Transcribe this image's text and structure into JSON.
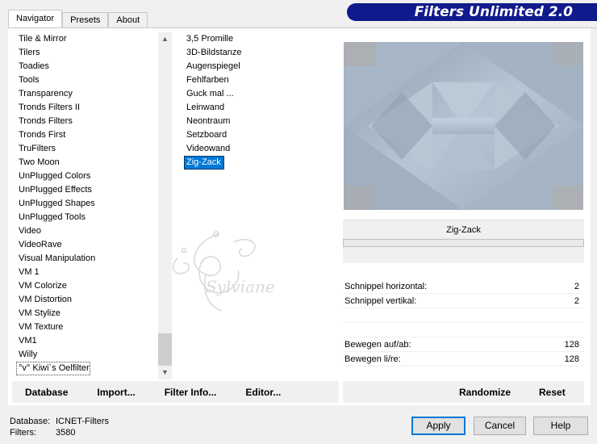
{
  "tabs": [
    {
      "label": "Navigator",
      "active": true
    },
    {
      "label": "Presets",
      "active": false
    },
    {
      "label": "About",
      "active": false
    }
  ],
  "banner": {
    "title": "Filters Unlimited 2.0",
    "color": "#111a8c"
  },
  "categories": [
    "Tile & Mirror",
    "Tilers",
    "Toadies",
    "Tools",
    "Transparency",
    "Tronds Filters II",
    "Tronds Filters",
    "Tronds First",
    "TruFilters",
    "Two Moon",
    "UnPlugged Colors",
    "UnPlugged Effects",
    "UnPlugged Shapes",
    "UnPlugged Tools",
    "Video",
    "VideoRave",
    "Visual Manipulation",
    "VM 1",
    "VM Colorize",
    "VM Distortion",
    "VM Stylize",
    "VM Texture",
    "VM1",
    "Willy",
    "°v° Kiwi`s Oelfilter"
  ],
  "selected_category": "°v° Kiwi`s Oelfilter",
  "filters": [
    "3,5 Promille",
    "3D-Bildstanze",
    "Augenspiegel",
    "Fehlfarben",
    "Guck mal ...",
    "Leinwand",
    "Neontraum",
    "Setzboard",
    "Videowand",
    "Zig-Zack"
  ],
  "selected_filter": "Zig-Zack",
  "selection_color": "#0078d7",
  "preview": {
    "filter_name": "Zig-Zack"
  },
  "params": [
    {
      "label": "Schnippel horizontal:",
      "value": "2"
    },
    {
      "label": "Schnippel vertikal:",
      "value": "2"
    },
    {
      "label": "Bewegen auf/ab:",
      "value": "128"
    },
    {
      "label": "Bewegen li/re:",
      "value": "128"
    }
  ],
  "toolbar": {
    "database": "Database",
    "import": "Import...",
    "filter_info": "Filter Info...",
    "editor": "Editor...",
    "randomize": "Randomize",
    "reset": "Reset"
  },
  "status": {
    "database_label": "Database:",
    "database_value": "ICNET-Filters",
    "filters_label": "Filters:",
    "filters_value": "3580"
  },
  "buttons": {
    "apply": "Apply",
    "cancel": "Cancel",
    "help": "Help"
  },
  "watermark": {
    "text": "Sylviane"
  }
}
